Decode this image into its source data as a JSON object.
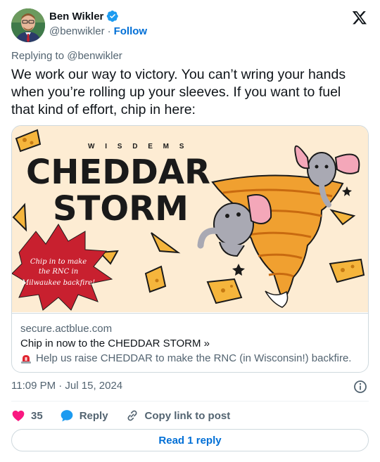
{
  "author": {
    "name": "Ben Wikler",
    "handle": "@benwikler",
    "separator": "·",
    "follow_label": "Follow",
    "avatar_icon": "person-avatar",
    "verified_icon": "verified-badge-icon",
    "verified_color": "#1d9bf0"
  },
  "platform_icon": "x-logo-icon",
  "tweet": {
    "replying_to": "Replying to @benwikler",
    "text": "We work our way to victory. You can’t wring your hands when you’re rolling up your sleeves. If you want to fuel that kind of effort, chip in here:"
  },
  "link_card": {
    "banner": {
      "org_label": "W I S D E M S",
      "headline_1": "CHEDDAR",
      "headline_2": "STORM",
      "starburst_text_1": "Chip in to make",
      "starburst_text_2": "the RNC in",
      "starburst_text_3": "Milwaukee backfire!",
      "background_color": "#fdecd3",
      "starburst_color": "#c8202f",
      "tornado_color": "#f0a030"
    },
    "domain": "secure.actblue.com",
    "title": "Chip in now to the CHEDDAR STORM »",
    "description": "Help us raise CHEDDAR to make the RNC (in Wisconsin!) backfire.",
    "description_icon": "siren-icon"
  },
  "meta": {
    "timestamp": "11:09 PM · Jul 15, 2024",
    "info_icon": "info-icon"
  },
  "actions": {
    "like_count": "35",
    "like_icon": "heart-icon",
    "like_color": "#f91880",
    "reply_label": "Reply",
    "reply_icon": "speech-bubble-icon",
    "reply_color": "#1d9bf0",
    "copy_label": "Copy link to post",
    "copy_icon": "link-icon"
  },
  "read_reply_label": "Read 1 reply"
}
